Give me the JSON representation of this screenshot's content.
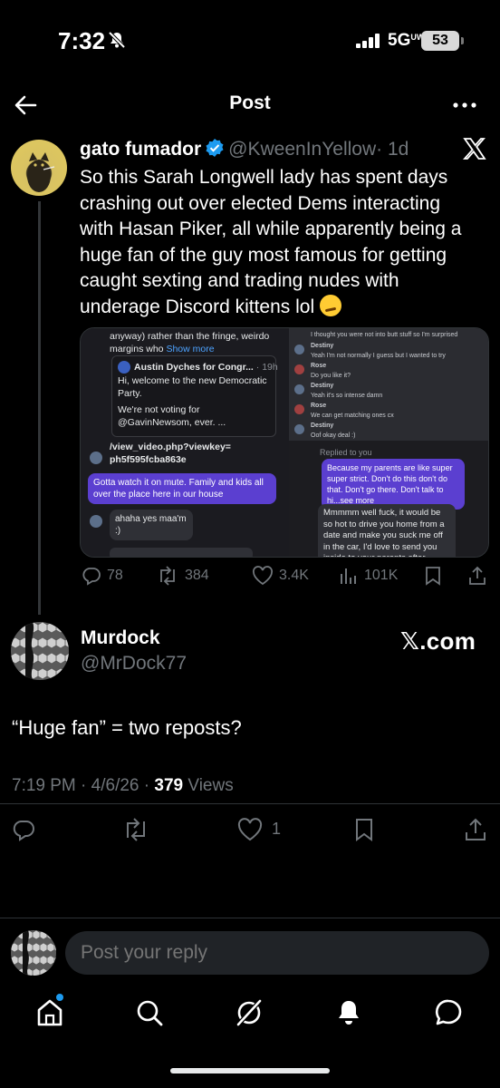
{
  "status_bar": {
    "time": "7:32",
    "network": "5G",
    "network_sub": "UW",
    "battery": "53"
  },
  "header": {
    "title": "Post"
  },
  "quoted_post": {
    "name": "gato fumador",
    "handle": "@KweenInYellow",
    "time": "· 1d",
    "text": "So this Sarah Longwell lady has spent days crashing out over elected Dems interacting with Hasan Piker, all while apparently being a huge fan of the guy most famous for getting caught sexting and trading nudes with underage Discord kittens lol",
    "media": {
      "left_text_1": "anyway) rather than the fringe, weirdo margins who",
      "show_more": "Show more",
      "card_name": "Austin Dyches for Congr...",
      "card_time": "· 19h",
      "card_text_1": "Hi, welcome to the new Democratic Party.",
      "card_text_2": "We're not voting for @GavinNewsom, ever. ...",
      "video_link": "/view_video.php?viewkey=ph5f595fcba863e",
      "bubble_1": "Gotta watch it on mute. Family and kids all over the place here in our house",
      "bubble_2": "ahaha yes maa'm :)",
      "chat_1": "I thought you were not into butt stuff so I'm surprised",
      "chat_2_name": "Destiny",
      "chat_2": "Yeah I'm not normally I guess but I wanted to try",
      "chat_3_name": "Rose",
      "chat_3": "Do you like it?",
      "chat_4_name": "Destiny",
      "chat_4": "Yeah it's so intense damn",
      "chat_5_name": "Rose",
      "chat_5": "We can get matching ones cx",
      "chat_6_name": "Destiny",
      "chat_6": "Oof okay deal :)",
      "replied_to": "Replied to you",
      "bubble_3": "Because my parents are like super super strict. Don't do this don't do that. Don't go there. Don't talk to hi...see more",
      "bubble_4": "Mmmmm well fuck, it would be so hot to drive you home from a date and make you suck me off in the car, I'd love to send you inside to your parents after making you"
    },
    "replies": "78",
    "reposts": "384",
    "likes": "3.4K",
    "views": "101K"
  },
  "reply": {
    "name": "Murdock",
    "handle": "@MrDock77",
    "badge": "𝕏.com",
    "text": "“Huge fan” = two reposts?",
    "time": "7:19 PM",
    "date": "4/6/26",
    "views_count": "379",
    "views_label": "Views",
    "likes": "1"
  },
  "composer": {
    "placeholder": "Post your reply"
  },
  "colors": {
    "accent": "#1d9bf0",
    "muted": "#71767b",
    "background": "#000000"
  }
}
